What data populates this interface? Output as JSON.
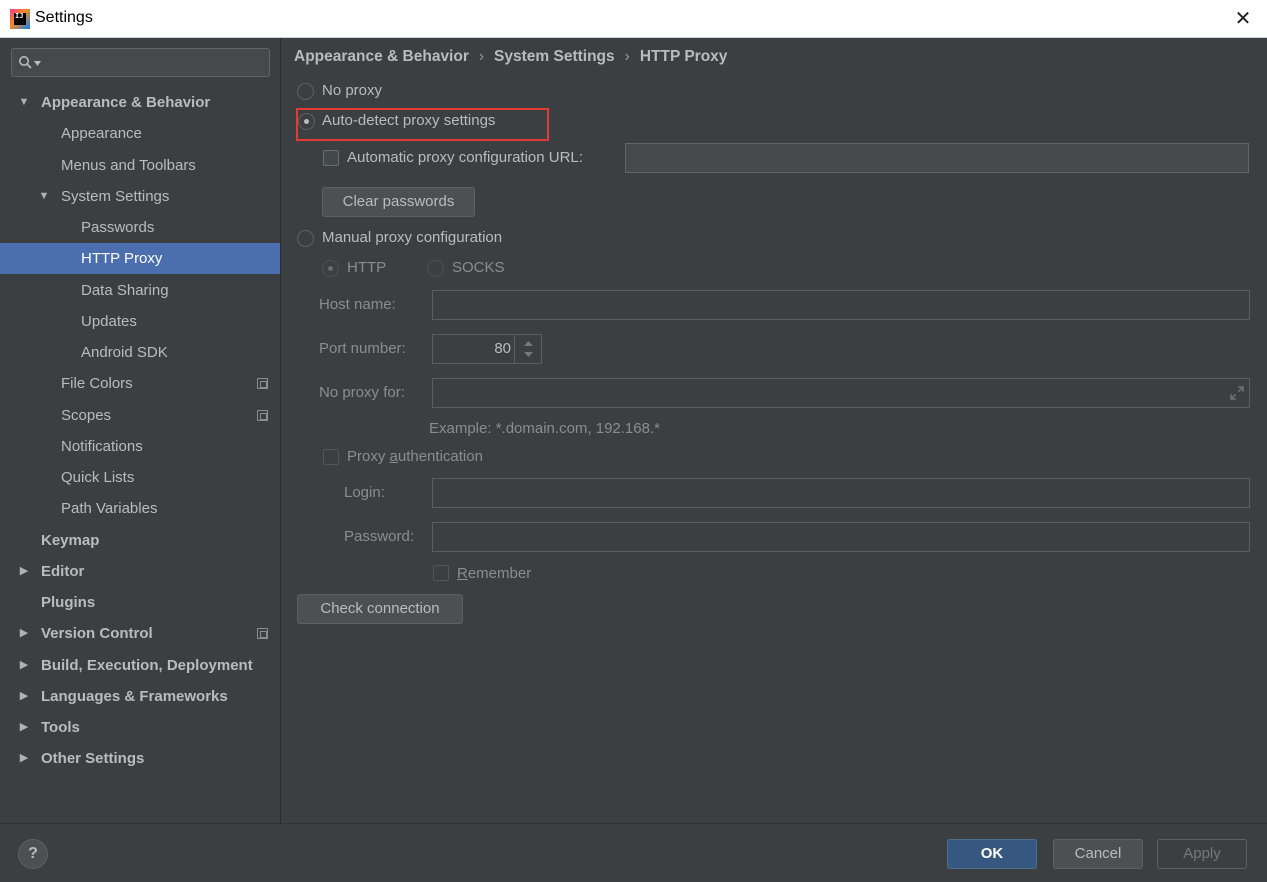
{
  "window": {
    "title": "Settings",
    "icon_letters": "IJ"
  },
  "sidebar": {
    "search": {
      "placeholder": ""
    },
    "items": [
      {
        "label": "Appearance & Behavior",
        "level": 0,
        "arrow": "▼",
        "bold": true
      },
      {
        "label": "Appearance",
        "level": 1
      },
      {
        "label": "Menus and Toolbars",
        "level": 1
      },
      {
        "label": "System Settings",
        "level": 1,
        "arrow": "▼"
      },
      {
        "label": "Passwords",
        "level": 2
      },
      {
        "label": "HTTP Proxy",
        "level": 2,
        "selected": true
      },
      {
        "label": "Data Sharing",
        "level": 2
      },
      {
        "label": "Updates",
        "level": 2
      },
      {
        "label": "Android SDK",
        "level": 2
      },
      {
        "label": "File Colors",
        "level": 1,
        "copy_icon": true
      },
      {
        "label": "Scopes",
        "level": 1,
        "copy_icon": true
      },
      {
        "label": "Notifications",
        "level": 1
      },
      {
        "label": "Quick Lists",
        "level": 1
      },
      {
        "label": "Path Variables",
        "level": 1
      },
      {
        "label": "Keymap",
        "level": 0,
        "bold": true
      },
      {
        "label": "Editor",
        "level": 0,
        "arrow": "▶",
        "bold": true
      },
      {
        "label": "Plugins",
        "level": 0,
        "bold": true
      },
      {
        "label": "Version Control",
        "level": 0,
        "arrow": "▶",
        "bold": true,
        "copy_icon": true
      },
      {
        "label": "Build, Execution, Deployment",
        "level": 0,
        "arrow": "▶",
        "bold": true
      },
      {
        "label": "Languages & Frameworks",
        "level": 0,
        "arrow": "▶",
        "bold": true
      },
      {
        "label": "Tools",
        "level": 0,
        "arrow": "▶",
        "bold": true
      },
      {
        "label": "Other Settings",
        "level": 0,
        "arrow": "▶",
        "bold": true
      }
    ]
  },
  "breadcrumb": [
    "Appearance & Behavior",
    "System Settings",
    "HTTP Proxy"
  ],
  "breadcrumb_separator": "›",
  "proxy": {
    "no_proxy_label": "No proxy",
    "auto_detect_label": "Auto-detect proxy settings",
    "auto_config_url_label": "Automatic proxy configuration URL:",
    "auto_config_url_value": "",
    "clear_passwords_label": "Clear passwords",
    "manual_label": "Manual proxy configuration",
    "http_label": "HTTP",
    "socks_label": "SOCKS",
    "host_label": "Host name:",
    "host_value": "",
    "port_label": "Port number:",
    "port_value": "80",
    "no_proxy_for_label": "No proxy for:",
    "no_proxy_for_value": "",
    "example_text": "Example: *.domain.com, 192.168.*",
    "proxy_auth_prefix": "Proxy ",
    "proxy_auth_underline": "a",
    "proxy_auth_suffix": "uthentication",
    "login_label": "Login:",
    "login_value": "",
    "password_label": "Password:",
    "password_value": "",
    "remember_underline": "R",
    "remember_suffix": "emember",
    "check_connection_label": "Check connection"
  },
  "footer": {
    "help_label": "?",
    "ok_label": "OK",
    "cancel_label": "Cancel",
    "apply_label": "Apply"
  },
  "colors": {
    "selection": "#4b6eaf",
    "highlight": "#e53935",
    "ok_button": "#365880"
  }
}
